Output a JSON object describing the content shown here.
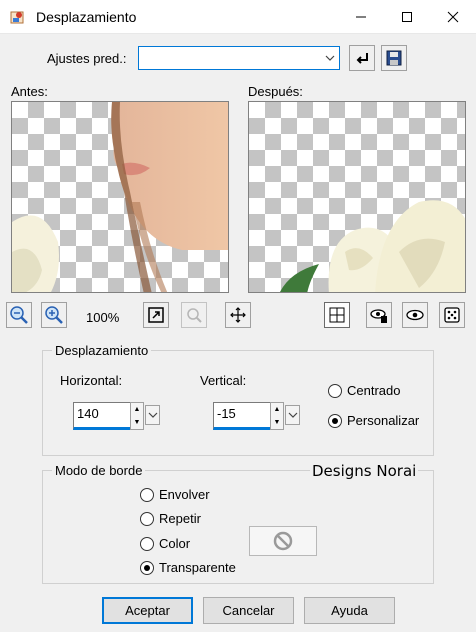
{
  "window": {
    "title": "Desplazamiento",
    "controls": [
      "minimize-icon",
      "maximize-icon",
      "close-icon"
    ]
  },
  "presets": {
    "label": "Ajustes pred.:",
    "value": "",
    "icons": [
      "reset-icon",
      "save-icon"
    ]
  },
  "previews": {
    "before_label": "Antes:",
    "after_label": "Después:"
  },
  "zoom": {
    "level": "100%",
    "icons": [
      "zoom-out-icon",
      "zoom-in-icon",
      "fit-window-icon",
      "zoom-disabled-icon",
      "move-icon",
      "preview-toggle-icon",
      "proof-icon",
      "eye-icon",
      "dice-icon"
    ]
  },
  "offset": {
    "group_label": "Desplazamiento",
    "horizontal_label": "Horizontal:",
    "horizontal_value": "140",
    "vertical_label": "Vertical:",
    "vertical_value": "-15",
    "options": [
      {
        "label": "Centrado",
        "selected": false
      },
      {
        "label": "Personalizar",
        "selected": true
      }
    ]
  },
  "edge_mode": {
    "group_label": "Modo de borde",
    "watermark": "Designs Norai",
    "options": [
      {
        "label": "Envolver",
        "selected": false
      },
      {
        "label": "Repetir",
        "selected": false
      },
      {
        "label": "Color",
        "selected": false
      },
      {
        "label": "Transparente",
        "selected": true
      }
    ],
    "color_swatch_icon": "no-color-icon"
  },
  "buttons": {
    "ok": "Aceptar",
    "cancel": "Cancelar",
    "help": "Ayuda"
  },
  "colors": {
    "accent": "#0078d7",
    "background": "#f0f0f0"
  }
}
